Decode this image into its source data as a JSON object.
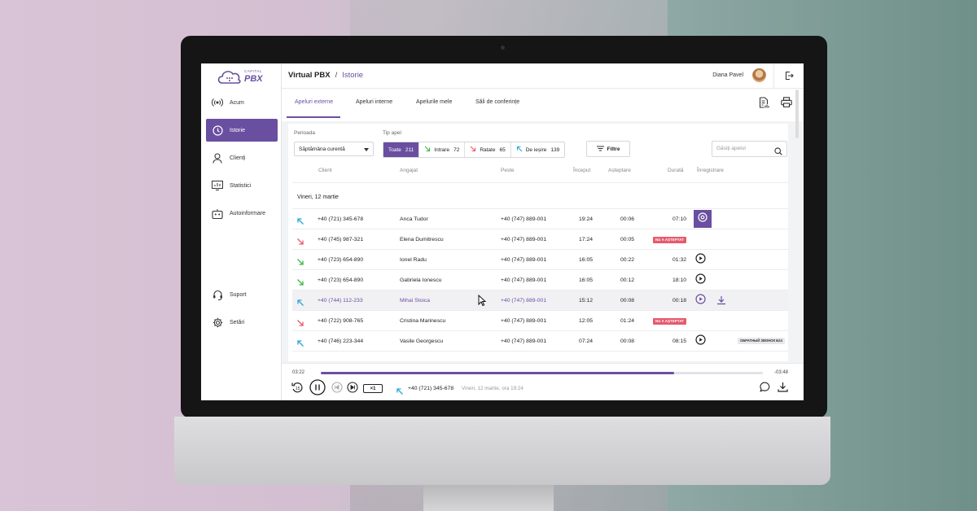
{
  "app": {
    "logo_small": "CAPITAL",
    "logo_big": "PBX"
  },
  "header": {
    "crumb_root": "Virtual PBX",
    "crumb_sep": "/",
    "crumb_current": "Istorie",
    "user_name": "Diana Pavel"
  },
  "sidebar": {
    "items": [
      {
        "label": "Acum",
        "icon": "live-broadcast-icon"
      },
      {
        "label": "Istorie",
        "icon": "clock-icon",
        "active": true
      },
      {
        "label": "Clienți",
        "icon": "person-icon"
      },
      {
        "label": "Statistici",
        "icon": "chart-icon"
      },
      {
        "label": "Autoinformare",
        "icon": "robot-icon"
      }
    ],
    "bottom": [
      {
        "label": "Suport",
        "icon": "headset-icon"
      },
      {
        "label": "Setări",
        "icon": "gear-icon"
      }
    ]
  },
  "tabs": [
    "Apeluri externe",
    "Apeluri interne",
    "Apelurile mele",
    "Săli de conferințe"
  ],
  "filters": {
    "period_label": "Perioada",
    "period_value": "Săptămâna curentă",
    "type_label": "Tip apel",
    "types": [
      {
        "label": "Toate",
        "count": "211"
      },
      {
        "label": "Intrare",
        "count": "72"
      },
      {
        "label": "Ratate",
        "count": "65"
      },
      {
        "label": "De ieșire",
        "count": "139"
      }
    ],
    "filter_button": "Filtre",
    "search_placeholder": "Găsiți apelul"
  },
  "table": {
    "headers": [
      "Client",
      "Angajat",
      "Peste",
      "Început",
      "Așteptare",
      "Durată",
      "Înregistrare"
    ],
    "day_label": "Vineri, 12 martie",
    "rows": [
      {
        "dir": "outgoing",
        "client": "+40 (721) 345-678",
        "employee": "Anca Tudor",
        "via": "+40 (747) 889-001",
        "start": "19:24",
        "wait": "00:06",
        "duration": "07:10",
        "rec": "playing"
      },
      {
        "dir": "missed",
        "client": "+40 (745) 987-321",
        "employee": "Elena Dumitrescu",
        "via": "+40 (747) 889-001",
        "start": "17:24",
        "wait": "00:05",
        "badge": "NU A AȘTEPTAT"
      },
      {
        "dir": "incoming",
        "client": "+40 (723) 654-890",
        "employee": "Ionel Radu",
        "via": "+40 (747) 889-001",
        "start": "16:05",
        "wait": "00:22",
        "duration": "01:32",
        "rec": "play"
      },
      {
        "dir": "incoming",
        "client": "+40 (723) 654-890",
        "employee": "Gabriela Ionescu",
        "via": "+40 (747) 889-001",
        "start": "16:05",
        "wait": "00:12",
        "duration": "18:10",
        "rec": "play"
      },
      {
        "dir": "outgoing",
        "client": "+40 (744) 112-233",
        "employee": "Mihai Stoica",
        "via": "+40 (747) 889-001",
        "start": "15:12",
        "wait": "00:08",
        "duration": "00:18",
        "rec": "play-download",
        "highlight": true
      },
      {
        "dir": "missed",
        "client": "+40 (722) 908-765",
        "employee": "Cristina Marinescu",
        "via": "+40 (747) 889-001",
        "start": "12:05",
        "wait": "01:24",
        "badge": "NU A AȘTEPTAT"
      },
      {
        "dir": "outgoing",
        "client": "+40 (746) 223-344",
        "employee": "Vasile Georgescu",
        "via": "+40 (747) 889-001",
        "start": "07:24",
        "wait": "00:08",
        "duration": "08:15",
        "rec": "play",
        "tag": "ОБРАТНЫЙ ЗВОНОК Б24"
      }
    ]
  },
  "player": {
    "elapsed": "03:22",
    "remaining": "-03:48",
    "progress_fraction": 0.8,
    "speed": "×1",
    "number": "+40 (721) 345-678",
    "date": "Vineri, 12 martie, ora 19:24"
  },
  "colors": {
    "accent": "#6a4fa1",
    "incoming": "#3bb54a",
    "missed": "#e65a6e",
    "outgoing": "#2aa6d6"
  }
}
